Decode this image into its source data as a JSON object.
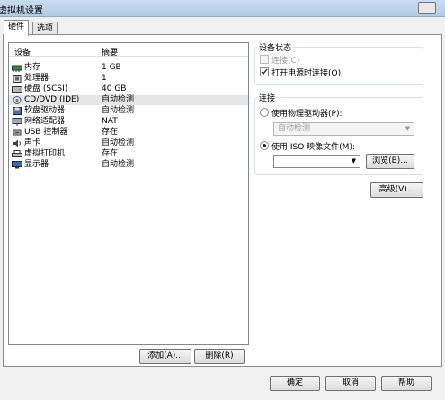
{
  "window": {
    "title": "虚拟机设置"
  },
  "tabs": [
    {
      "label": "硬件",
      "active": true
    },
    {
      "label": "选项",
      "active": false
    }
  ],
  "hardware_list": {
    "columns": [
      "设备",
      "摘要"
    ],
    "rows": [
      {
        "icon": "memory-icon",
        "device": "内存",
        "summary": "1 GB"
      },
      {
        "icon": "processor-icon",
        "device": "处理器",
        "summary": "1"
      },
      {
        "icon": "hard-disk-icon",
        "device": "硬盘 (SCSI)",
        "summary": "40 GB"
      },
      {
        "icon": "cd-dvd-icon",
        "device": "CD/DVD (IDE)",
        "summary": "自动检测",
        "selected": true
      },
      {
        "icon": "floppy-icon",
        "device": "软盘驱动器",
        "summary": "自动检测"
      },
      {
        "icon": "network-adapter-icon",
        "device": "网络适配器",
        "summary": "NAT"
      },
      {
        "icon": "usb-controller-icon",
        "device": "USB 控制器",
        "summary": "存在"
      },
      {
        "icon": "sound-card-icon",
        "device": "声卡",
        "summary": "自动检测"
      },
      {
        "icon": "printer-icon",
        "device": "虚拟打印机",
        "summary": "存在"
      },
      {
        "icon": "display-icon",
        "device": "显示器",
        "summary": "自动检测"
      }
    ]
  },
  "list_buttons": {
    "add": "添加(A)...",
    "remove": "删除(R)"
  },
  "device_status": {
    "label": "设备状态",
    "connected": {
      "label": "连接(C)",
      "checked": false,
      "disabled": true
    },
    "connect_on_power": {
      "label": "打开电源时连接(O)",
      "checked": true
    }
  },
  "connection": {
    "label": "连接",
    "physical": {
      "label": "使用物理驱动器(P):",
      "selected": false
    },
    "physical_value": "自动检测",
    "iso": {
      "label": "使用 ISO 映像文件(M):",
      "selected": true
    },
    "iso_value": "",
    "browse": "浏览(B)..."
  },
  "advanced": "高级(V)...",
  "footer": {
    "ok": "确定",
    "cancel": "取消",
    "help": "帮助"
  },
  "colors": {
    "titlebar": "#b3cbe4",
    "panel": "#ffffff",
    "window_bg": "#f0f0f0"
  }
}
